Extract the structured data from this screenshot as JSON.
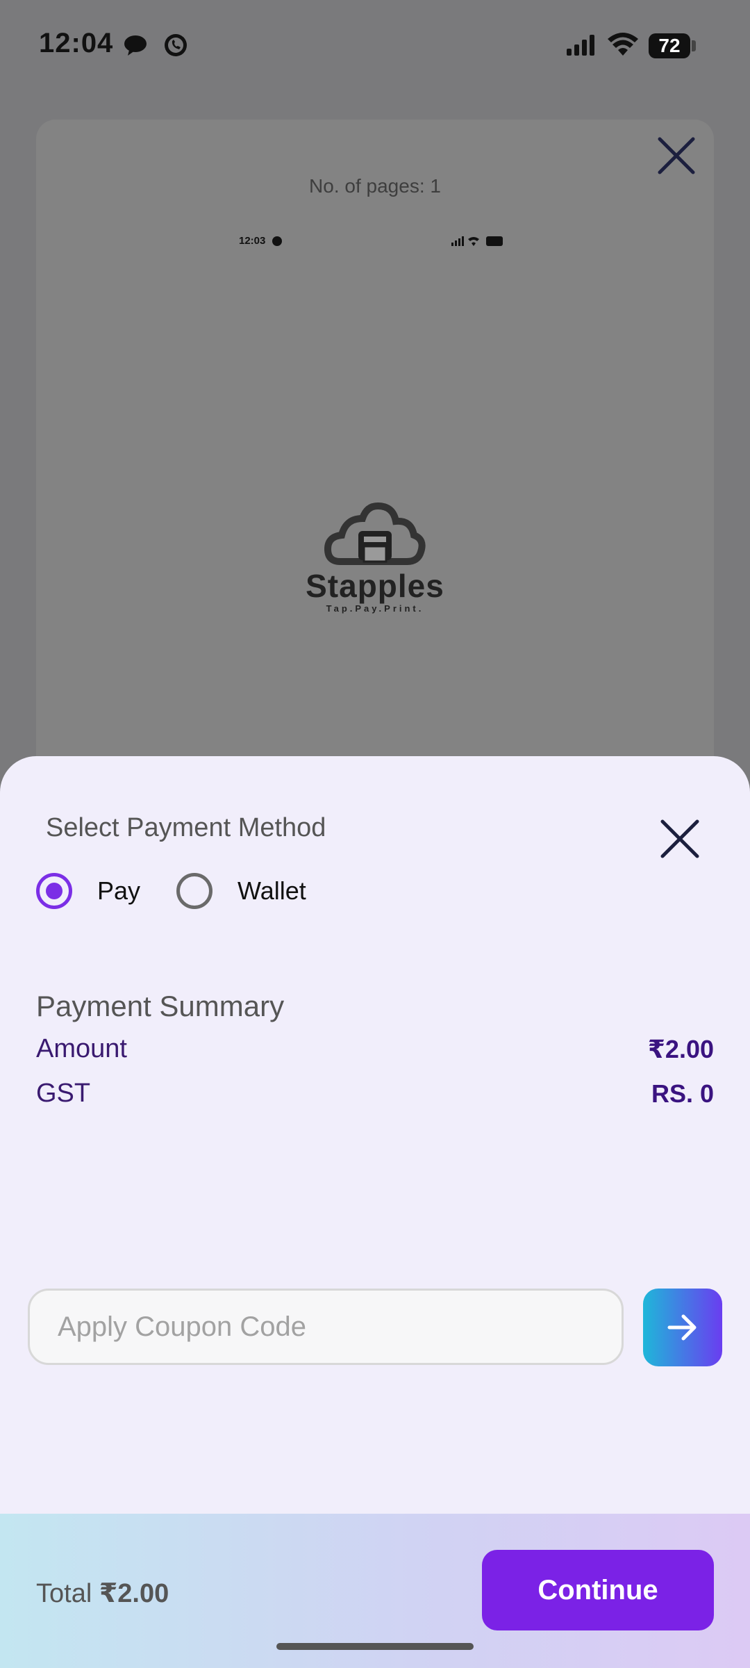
{
  "status_bar": {
    "time": "12:04",
    "battery": "72"
  },
  "preview": {
    "pages_label": "No. of pages: 1",
    "mini_time": "12:03",
    "mini_battery": "72",
    "logo_name": "Stapples",
    "logo_tagline": "Tap.Pay.Print."
  },
  "sheet": {
    "title": "Select Payment Method",
    "payment_options": [
      {
        "label": "Pay",
        "selected": true
      },
      {
        "label": "Wallet",
        "selected": false
      }
    ],
    "summary": {
      "title": "Payment Summary",
      "amount_label": "Amount",
      "amount_value": "₹2.00",
      "gst_label": "GST",
      "gst_value": "RS. 0"
    },
    "coupon": {
      "placeholder": "Apply Coupon Code",
      "value": ""
    },
    "footer": {
      "total_label": "Total",
      "total_value": "₹2.00",
      "continue_label": "Continue"
    }
  },
  "colors": {
    "accent": "#7b22e6",
    "overlay": "#7a7a7c",
    "sheet_bg": "#f1eefb",
    "amount_text": "#3a1380"
  },
  "icons": [
    "message-icon",
    "whatsapp-icon",
    "signal-icon",
    "wifi-icon",
    "battery-icon",
    "close-icon",
    "arrow-right-icon",
    "printer-cloud-logo"
  ]
}
